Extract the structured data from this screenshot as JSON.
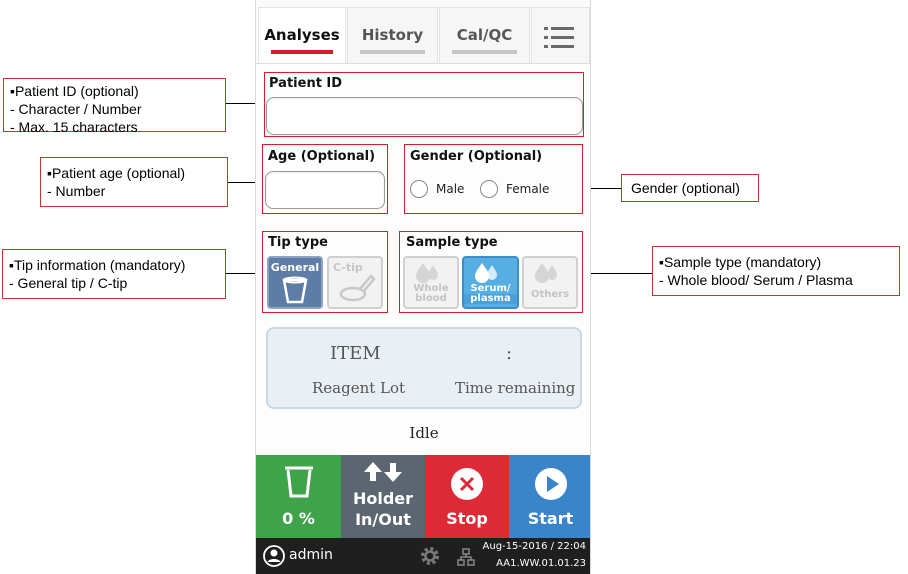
{
  "annotations": {
    "patient_id": [
      "▪Patient ID (optional)",
      "-   Character / Number",
      "-   Max. 15 characters"
    ],
    "patient_age": [
      "▪Patient age (optional)",
      "-   Number"
    ],
    "tip_info": [
      "▪Tip information (mandatory)",
      "- General tip / C-tip"
    ],
    "gender": [
      "Gender (optional)"
    ],
    "sample_type": [
      "▪Sample type (mandatory)",
      "-   Whole blood/ Serum / Plasma"
    ]
  },
  "tabs": [
    {
      "label": "Analyses",
      "active": true
    },
    {
      "label": "History",
      "active": false
    },
    {
      "label": "Cal/QC",
      "active": false
    }
  ],
  "menu_icon": "list-menu-icon",
  "form": {
    "patient_id_label": "Patient ID",
    "patient_id_value": "",
    "age_label": "Age (Optional)",
    "age_value": "",
    "gender_label": "Gender (Optional)",
    "gender_options": [
      "Male",
      "Female"
    ],
    "tip_type_label": "Tip type",
    "tip_options": [
      {
        "label": "General",
        "selected": true
      },
      {
        "label": "C-tip",
        "selected": false
      }
    ],
    "sample_type_label": "Sample type",
    "sample_options": [
      {
        "label_1": "Whole",
        "label_2": "blood",
        "selected": false
      },
      {
        "label_1": "Serum/",
        "label_2": "plasma",
        "selected": true
      },
      {
        "label_1": "Others",
        "label_2": "",
        "selected": false
      }
    ]
  },
  "status_panel": {
    "item": "ITEM",
    "separator": ":",
    "reagent_lot": "Reagent Lot",
    "time_remaining": "Time remaining"
  },
  "state": "Idle",
  "actions": {
    "waste_label": "0 %",
    "holder_line1": "Holder",
    "holder_line2": "In/Out",
    "stop_label": "Stop",
    "start_label": "Start"
  },
  "footer": {
    "user": "admin",
    "datetime": "Aug-15-2016 / 22:04",
    "version": "AA1.WW.01.01.23"
  },
  "colors": {
    "accent_red": "#d11f2e",
    "waste_green": "#3fa34a",
    "holder_gray": "#5b6670",
    "stop_red": "#dd2a36",
    "start_blue": "#3a85c9",
    "tip_selected": "#5d7ca6",
    "sample_selected": "#56aee3"
  }
}
